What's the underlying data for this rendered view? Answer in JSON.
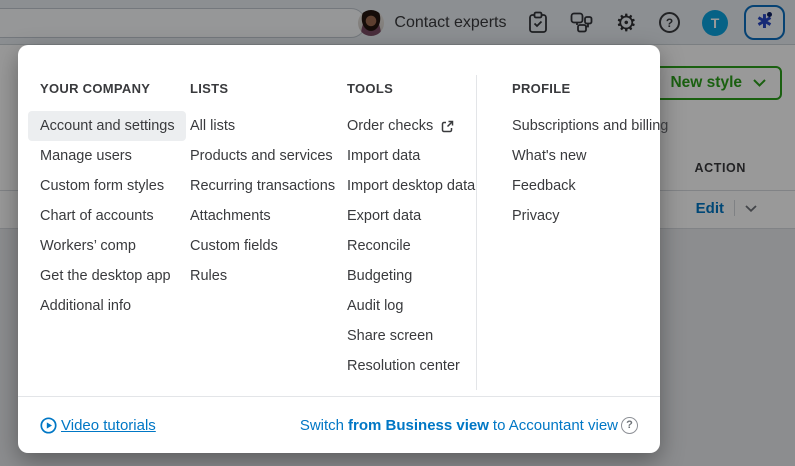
{
  "topbar": {
    "contact_experts": "Contact experts",
    "user_initial": "T",
    "gear_glyph": "⚙",
    "help_glyph": "?",
    "assist_glyph": "✱"
  },
  "background_page": {
    "new_style_label": "New style",
    "action_header": "ACTION",
    "edit_label": "Edit"
  },
  "menu": {
    "columns": [
      {
        "title": "YOUR COMPANY",
        "items": [
          "Account and settings",
          "Manage users",
          "Custom form styles",
          "Chart of accounts",
          "Workers’ comp",
          "Get the desktop app",
          "Additional info"
        ]
      },
      {
        "title": "LISTS",
        "items": [
          "All lists",
          "Products and services",
          "Recurring transactions",
          "Attachments",
          "Custom fields",
          "Rules"
        ]
      },
      {
        "title": "TOOLS",
        "items": [
          "Order checks",
          "Import data",
          "Import desktop data",
          "Export data",
          "Reconcile",
          "Budgeting",
          "Audit log",
          "Share screen",
          "Resolution center"
        ]
      },
      {
        "title": "PROFILE",
        "items": [
          "Subscriptions and billing",
          "What's new",
          "Feedback",
          "Privacy"
        ]
      }
    ],
    "selected_item": "Account and settings",
    "footer": {
      "video_tutorials": "Video tutorials",
      "switch_prefix": "Switch",
      "switch_bold": "from Business view",
      "switch_suffix": "to Accountant view",
      "help_glyph": "?"
    }
  },
  "colors": {
    "accent_green": "#2ca01c",
    "link_blue": "#0077c5",
    "text_dark": "#393a3d"
  }
}
